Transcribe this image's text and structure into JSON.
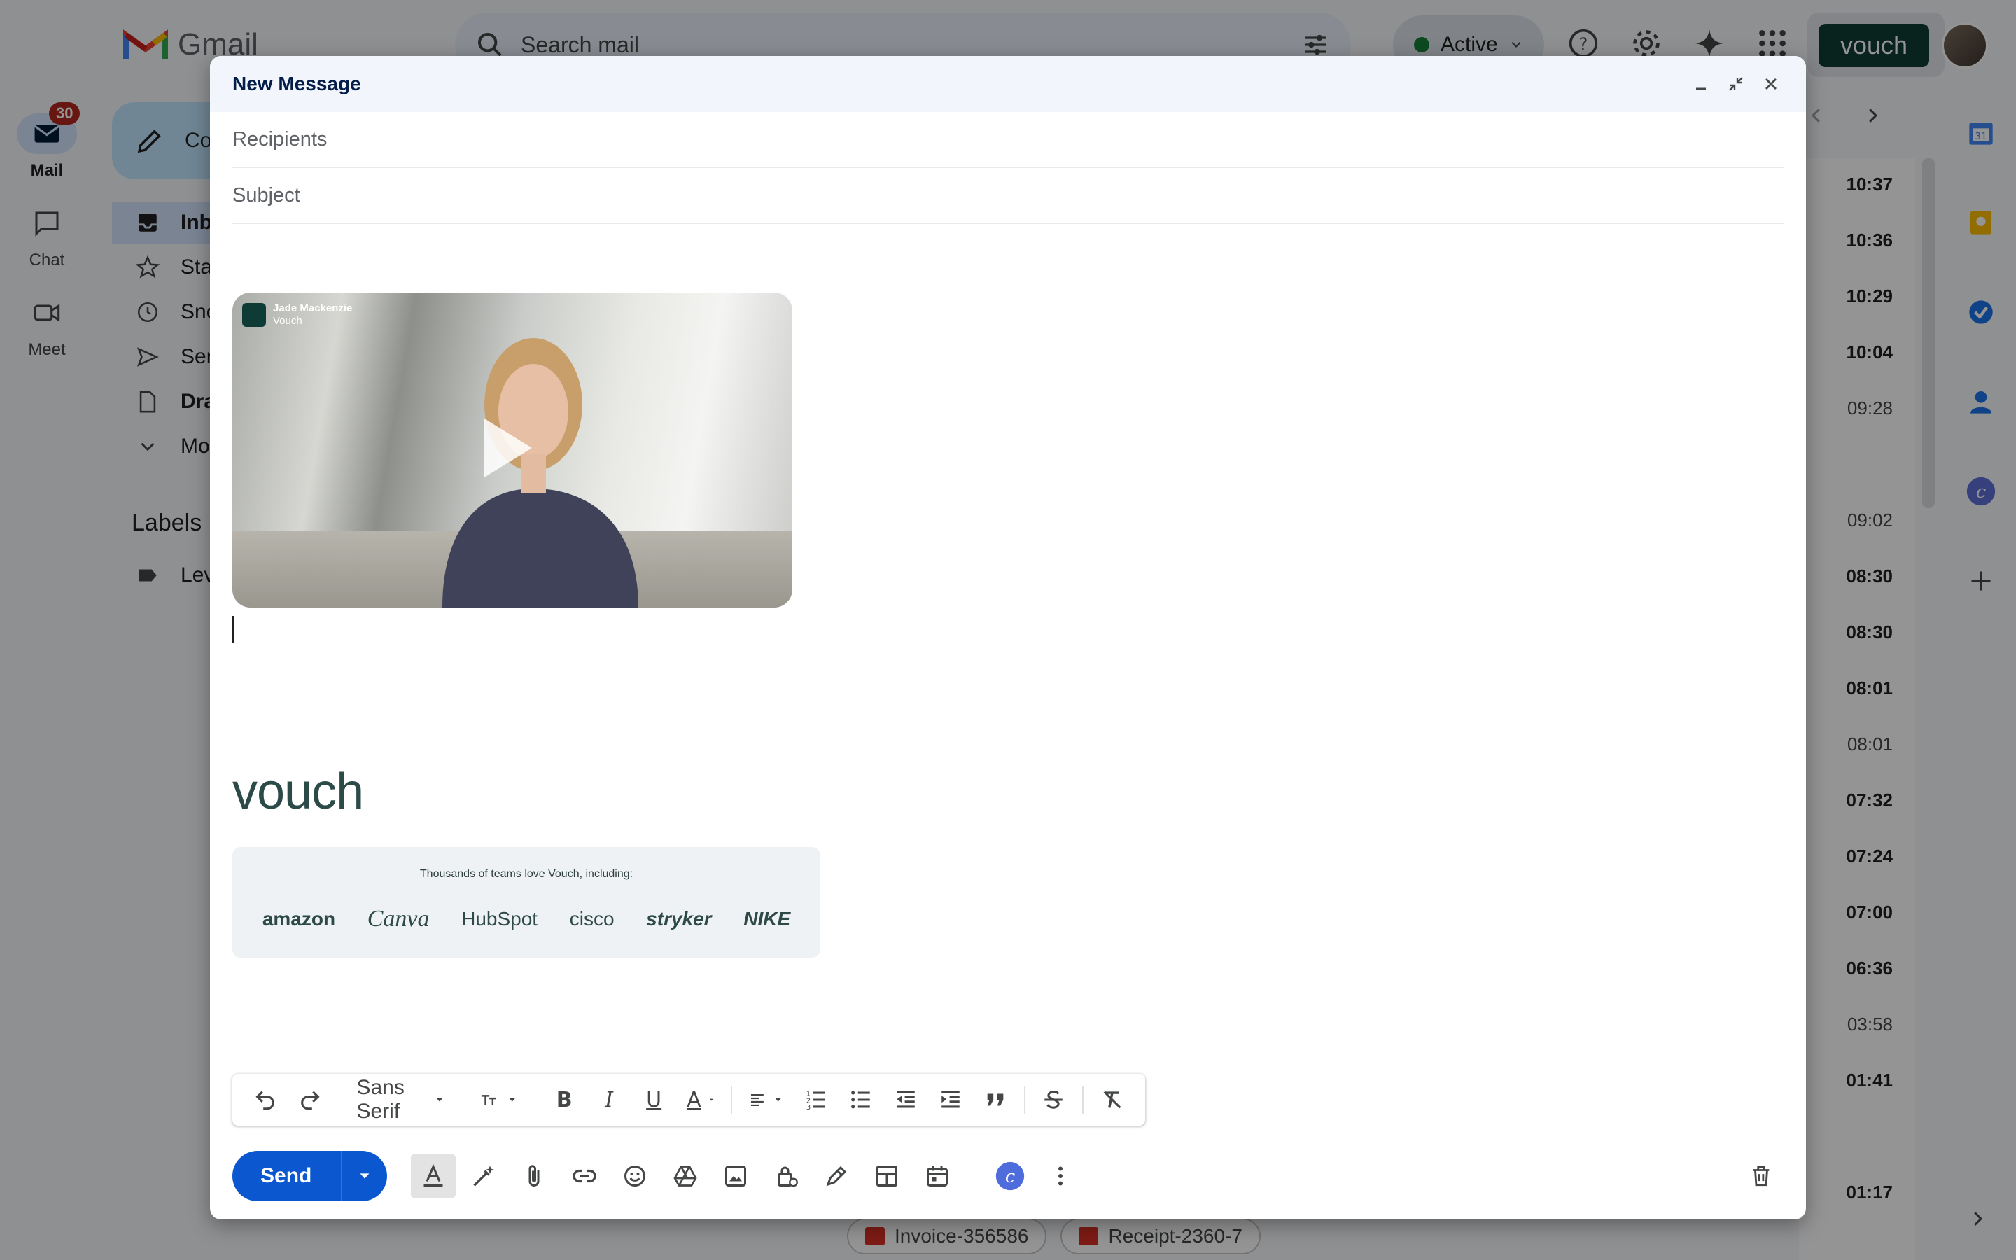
{
  "background": {
    "app_title": "Gmail",
    "search": {
      "placeholder": "Search mail"
    },
    "status": "Active",
    "brand_button": "vouch",
    "rail": {
      "mail": {
        "label": "Mail",
        "badge": "30"
      },
      "chat": {
        "label": "Chat"
      },
      "meet": {
        "label": "Meet"
      }
    },
    "nav": {
      "compose": "Co",
      "inbox": "Inb",
      "starred": "Sta",
      "snoozed": "Sno",
      "sent": "Sen",
      "drafts": "Dra",
      "more": "Mo"
    },
    "labels_heading": "Labels",
    "label_item": "Lev",
    "mail_times": [
      {
        "t": "10:37",
        "unread": true
      },
      {
        "t": "10:36",
        "unread": true
      },
      {
        "t": "10:29",
        "unread": true
      },
      {
        "t": "10:04",
        "unread": true
      },
      {
        "t": "09:28",
        "unread": false
      },
      {
        "t": "09:02",
        "unread": false
      },
      {
        "t": "08:30",
        "unread": true
      },
      {
        "t": "08:30",
        "unread": true
      },
      {
        "t": "08:01",
        "unread": true
      },
      {
        "t": "08:01",
        "unread": false
      },
      {
        "t": "07:32",
        "unread": true
      },
      {
        "t": "07:24",
        "unread": true
      },
      {
        "t": "07:00",
        "unread": true
      },
      {
        "t": "06:36",
        "unread": true
      },
      {
        "t": "03:58",
        "unread": false
      },
      {
        "t": "01:41",
        "unread": true
      },
      {
        "t": "01:17",
        "unread": true
      }
    ],
    "attachments": [
      "Invoice-356586",
      "Receipt-2360-7"
    ]
  },
  "compose": {
    "title": "New Message",
    "recipients_placeholder": "Recipients",
    "subject_placeholder": "Subject",
    "video": {
      "presenter_name": "Jade Mackenzie",
      "presenter_company": "Vouch"
    },
    "signature": {
      "logo_text": "vouch",
      "caption": "Thousands of teams love Vouch, including:",
      "logos": [
        "amazon",
        "Canva",
        "HubSpot",
        "cisco",
        "stryker",
        "NIKE"
      ]
    },
    "format_bar": {
      "font": "Sans Serif"
    },
    "send_label": "Send"
  },
  "colors": {
    "send": "#0b57d0",
    "header": "#f2f6fc",
    "brand": "#0e3b35",
    "overlay": "rgba(0,0,0,0.42)"
  }
}
